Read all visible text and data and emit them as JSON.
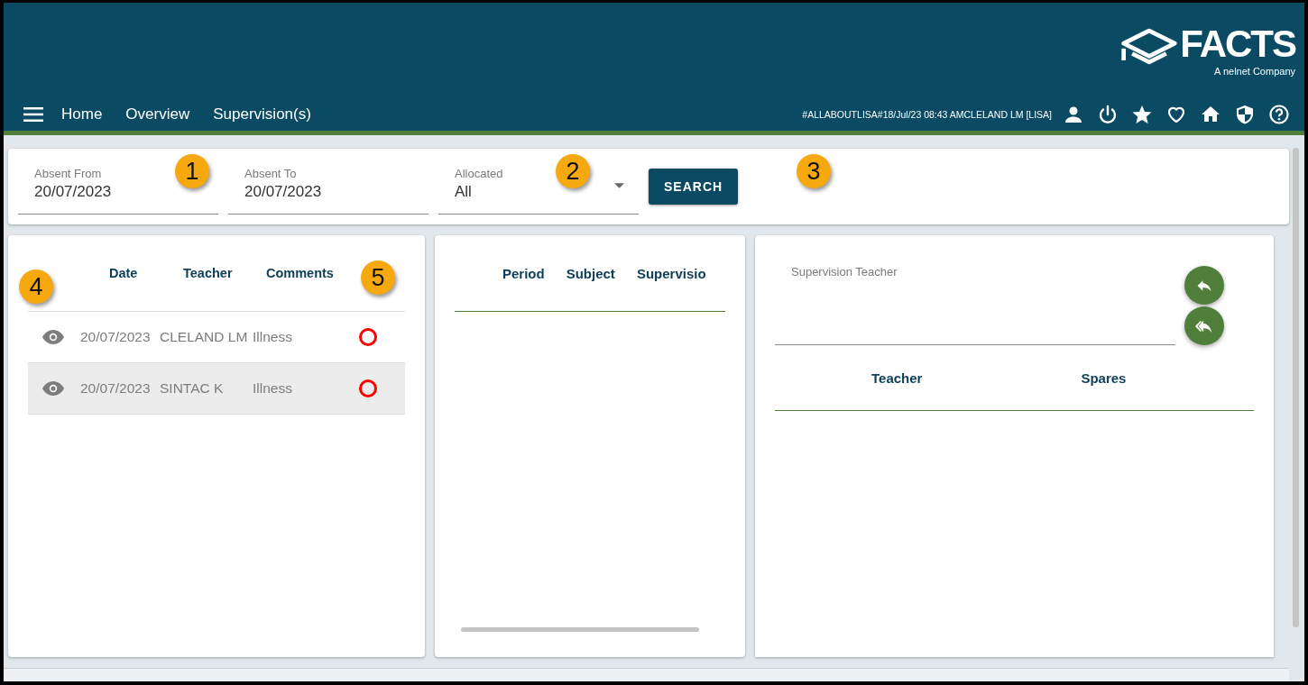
{
  "header": {
    "logo_text": "FACTS",
    "logo_tagline": "A nelnet Company",
    "nav": [
      {
        "label": "Home"
      },
      {
        "label": "Overview"
      },
      {
        "label": "Supervision(s)"
      }
    ],
    "status_text": "#ALLABOUTLISA#18/Jul/23 08:43 AMCLELAND LM [LISA]"
  },
  "filters": {
    "fields": [
      {
        "kind": "text",
        "label": "Absent From",
        "value": "20/07/2023"
      },
      {
        "kind": "text",
        "label": "Absent To",
        "value": "20/07/2023"
      },
      {
        "kind": "select",
        "label": "Allocated",
        "value": "All"
      }
    ],
    "search_button": "SEARCH"
  },
  "absences": {
    "columns": [
      "Date",
      "Teacher",
      "Comments"
    ],
    "rows": [
      {
        "date": "20/07/2023",
        "teacher": "CLELAND LM",
        "comment": "Illness",
        "selected": false
      },
      {
        "date": "20/07/2023",
        "teacher": "SINTAC K",
        "comment": "Illness",
        "selected": true
      }
    ]
  },
  "periods": {
    "columns": [
      "Period",
      "Subject",
      "Supervisio"
    ]
  },
  "supervision": {
    "field_label": "Supervision Teacher",
    "columns": [
      "Teacher",
      "Spares"
    ]
  },
  "callouts": [
    "1",
    "2",
    "3",
    "4",
    "5"
  ]
}
